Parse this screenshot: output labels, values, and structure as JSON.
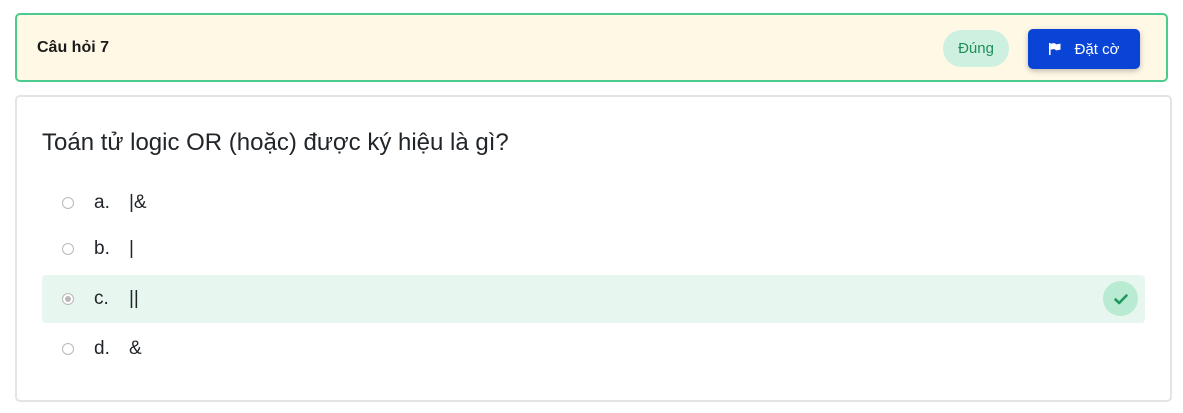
{
  "header": {
    "question_label": "Câu hỏi 7",
    "status": "Đúng",
    "flag_label": "Đặt cờ"
  },
  "question": {
    "text": "Toán tử logic OR (hoặc) được ký hiệu là gì?",
    "options": [
      {
        "letter": "a.",
        "text": "|&",
        "selected": false,
        "correct": false
      },
      {
        "letter": "b.",
        "text": "|",
        "selected": false,
        "correct": false
      },
      {
        "letter": "c.",
        "text": "||",
        "selected": true,
        "correct": true
      },
      {
        "letter": "d.",
        "text": "&",
        "selected": false,
        "correct": false
      }
    ]
  },
  "colors": {
    "header_bg": "#fff8e5",
    "header_border": "#4ccb8e",
    "status_bg": "#cdf0e0",
    "status_text": "#1f8f5a",
    "flag_button_bg": "#0a44d6",
    "correct_row_bg": "#e7f7ef",
    "check_icon": "#1f9a5e"
  },
  "icons": {
    "flag": "flag-icon",
    "correct": "check-icon"
  }
}
